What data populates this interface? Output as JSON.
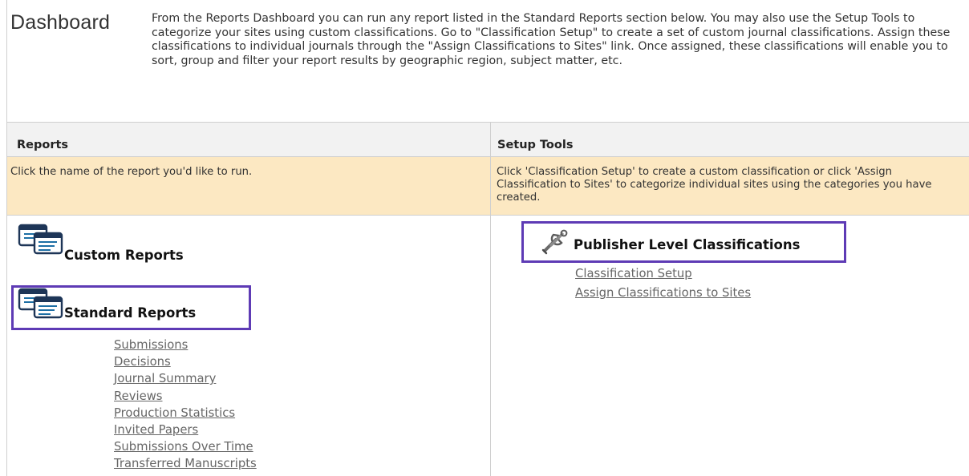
{
  "header": {
    "title": "Dashboard",
    "intro": "From the Reports Dashboard you can run any report listed in the Standard Reports section below. You may also use the Setup Tools to categorize your sites using custom classifications. Go to \"Classification Setup\" to create a set of custom journal classifications. Assign these classifications to individual journals through the \"Assign Classifications to Sites\" link. Once assigned, these classifications will enable you to sort, group and filter your report results by geographic region, subject matter, etc."
  },
  "reports": {
    "heading": "Reports",
    "description": "Click the name of the report you'd like to run.",
    "custom_title": "Custom Reports",
    "standard_title": "Standard Reports",
    "standard_links": [
      "Submissions",
      "Decisions",
      "Journal Summary",
      "Reviews",
      "Production Statistics",
      "Invited Papers",
      "Submissions Over Time",
      "Transferred Manuscripts"
    ]
  },
  "setup": {
    "heading": "Setup Tools",
    "description": "Click 'Classification Setup' to create a custom classification or click 'Assign Classification to Sites' to categorize individual sites using the categories you have created.",
    "section_title": "Publisher Level Classifications",
    "links": [
      "Classification Setup",
      "Assign Classifications to Sites"
    ]
  },
  "icons": {
    "report": "report-icon",
    "wrench": "wrench-icon"
  },
  "colors": {
    "highlight": "#5e3bb5",
    "description_bg": "#fce8c2",
    "header_bg": "#f2f2f2",
    "link": "#666666"
  }
}
